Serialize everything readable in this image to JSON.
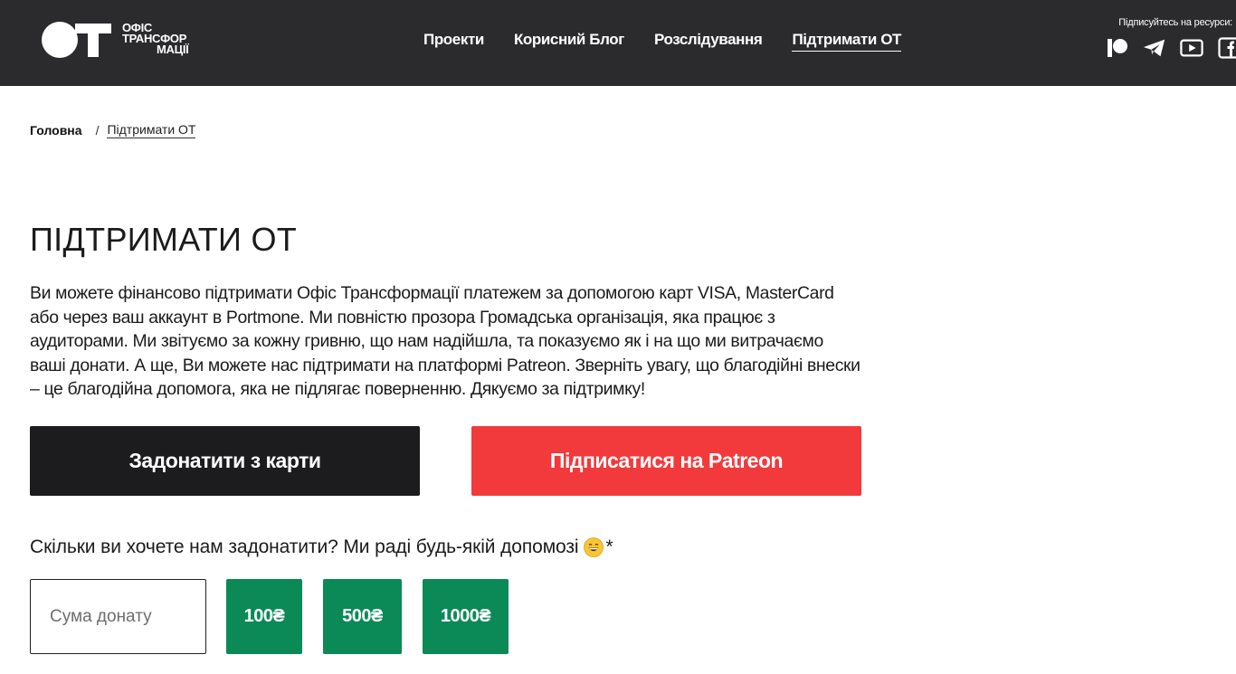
{
  "header": {
    "logo": {
      "mark": "ОТ",
      "line1": "ОФІС",
      "line2": "ТРАНСФОР",
      "line3": "МАЦІЇ"
    },
    "nav": [
      {
        "label": "Проекти",
        "active": false
      },
      {
        "label": "Корисний Блог",
        "active": false
      },
      {
        "label": "Розслідування",
        "active": false
      },
      {
        "label": "Підтримати ОТ",
        "active": true
      }
    ],
    "socials_label": "Підписуйтесь на ресурси:",
    "socials": [
      "patreon-icon",
      "telegram-icon",
      "youtube-icon",
      "facebook-icon"
    ]
  },
  "breadcrumb": {
    "home": "Головна",
    "separator": "/",
    "current": "Підтримати ОТ"
  },
  "main": {
    "title": "ПІДТРИМАТИ ОТ",
    "description": "Ви можете фінансово підтримати Офіс Трансформації платежем за допомогою карт VISA, MasterCard або через ваш аккаунт в Portmone. Ми повністю прозора Громадська організація, яка працює з аудиторами. Ми звітуємо за кожну гривню, що нам надійшла, та показуємо як і на що ми витрачаємо ваші донати. А ще, Ви можете нас підтримати на платформі Patreon. Зверніть увагу, що благодійні внески – це благодійна допомога, яка не підлягає поверненню. Дякуємо за підтримку!",
    "donate_card_label": "Задонатити з карти",
    "patreon_label": "Підписатися на Patreon",
    "question": "Скільки ви хочете нам задонатити? Ми раді будь-якій допомозі",
    "question_emoji": "grinning-face-emoji",
    "asterisk": "*",
    "amount_placeholder": "Сума донату",
    "amount_options": [
      "100₴",
      "500₴",
      "1000₴"
    ]
  },
  "colors": {
    "header_bg": "#2b2a2d",
    "card_button": "#1c1c1e",
    "patreon_button": "#f23a3c",
    "amount_button": "#0b8957"
  }
}
